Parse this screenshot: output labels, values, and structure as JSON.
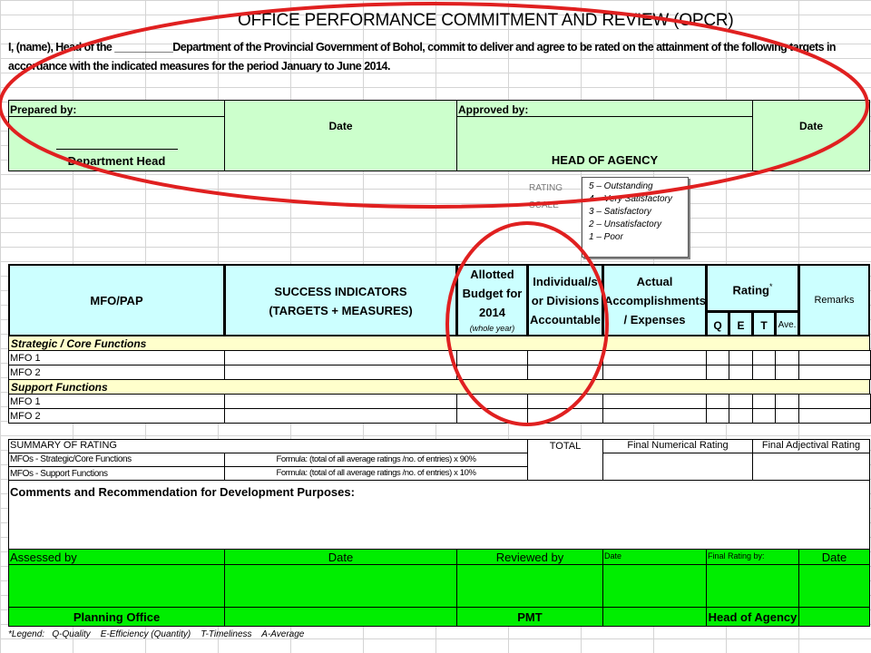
{
  "title": "OFFICE PERFORMANCE COMMITMENT AND REVIEW (OPCR)",
  "intro": {
    "line1": "I, (name), Head of the __________Department of the Provincial Government of Bohol, commit to deliver and agree to be rated on the attainment of the following targets in",
    "line2": "accordance with the indicated measures for the period January to June 2014."
  },
  "signature": {
    "prepared_by": "Prepared by:",
    "date1": "Date",
    "approved_by": "Approved by:",
    "date2": "Date",
    "department_head": "Department Head",
    "head_of_agency": "HEAD OF AGENCY"
  },
  "rating_scale": {
    "label1": "RATING",
    "label2": "SCALE",
    "items": [
      "5 – Outstanding",
      "4 – Very Satisfactory",
      "3 – Satisfactory",
      "2 – Unsatisfactory",
      "1 – Poor"
    ]
  },
  "table": {
    "headers": {
      "mfo": "MFO/PAP",
      "success1": "SUCCESS INDICATORS",
      "success2": "(TARGETS + MEASURES)",
      "budget1": "Allotted",
      "budget2": "Budget for",
      "budget3": "2014",
      "budget4": "(whole year)",
      "indiv1": "Individual/s",
      "indiv2": "or Divisions",
      "indiv3": "Accountable",
      "actual1": "Actual",
      "actual2": "Accomplishments",
      "actual3": "/ Expenses",
      "rating": "Rating",
      "rating_mark": "*",
      "q": "Q",
      "e": "E",
      "t": "T",
      "ave": "Ave.",
      "remarks": "Remarks"
    },
    "sections": [
      {
        "title": "Strategic / Core Functions",
        "rows": [
          "MFO 1",
          "MFO 2"
        ]
      },
      {
        "title": "Support Functions",
        "rows": [
          "MFO 1",
          "MFO 2"
        ]
      }
    ]
  },
  "summary": {
    "label": "SUMMARY  OF RATING",
    "total": "TOTAL",
    "final_numerical": "Final Numerical Rating",
    "final_adjectival": "Final Adjectival Rating",
    "row1_label": "MFOs - Strategic/Core Functions",
    "row1_formula": "Formula: (total of all average ratings /no. of entries) x 90%",
    "row2_label": "MFOs - Support Functions",
    "row2_formula": "Formula: (total of all average ratings /no. of entries) x 10%"
  },
  "comments": "Comments and Recommendation for Development Purposes:",
  "assessment": {
    "assessed_by": "Assessed by",
    "date1": "Date",
    "reviewed_by": "Reviewed by",
    "date2": "Date",
    "final_rating_by": "Final Rating by:",
    "date3": "Date",
    "planning_office": "Planning Office",
    "pmt": "PMT",
    "head_of_agency": "Head of Agency"
  },
  "legend": "*Legend:   Q-Quality    E-Efficiency (Quantity)    T-Timeliness    A-Average",
  "colors": {
    "header_cyan": "#ccffff",
    "light_green": "#ccffcc",
    "section_yellow": "#ffffcc",
    "bright_green": "#00ee00",
    "annotation_red": "#e02020"
  }
}
